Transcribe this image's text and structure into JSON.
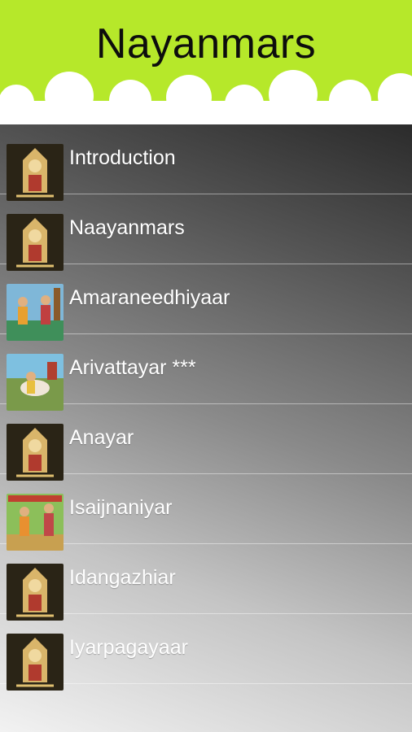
{
  "header": {
    "title": "Nayanmars",
    "background_color": "#b6e82a"
  },
  "list": {
    "items": [
      {
        "label": "Introduction",
        "thumb": "deity-icon"
      },
      {
        "label": "Naayanmars",
        "thumb": "deity-icon"
      },
      {
        "label": "Amaraneedhiyaar",
        "thumb": "painting-blue-icon"
      },
      {
        "label": "Arivattayar ***",
        "thumb": "painting-cow-icon"
      },
      {
        "label": "Anayar",
        "thumb": "deity-icon"
      },
      {
        "label": "Isaijnaniyar",
        "thumb": "painting-green-icon"
      },
      {
        "label": "Idangazhiar",
        "thumb": "deity-icon"
      },
      {
        "label": "Iyarpagayaar",
        "thumb": "deity-icon"
      }
    ]
  }
}
